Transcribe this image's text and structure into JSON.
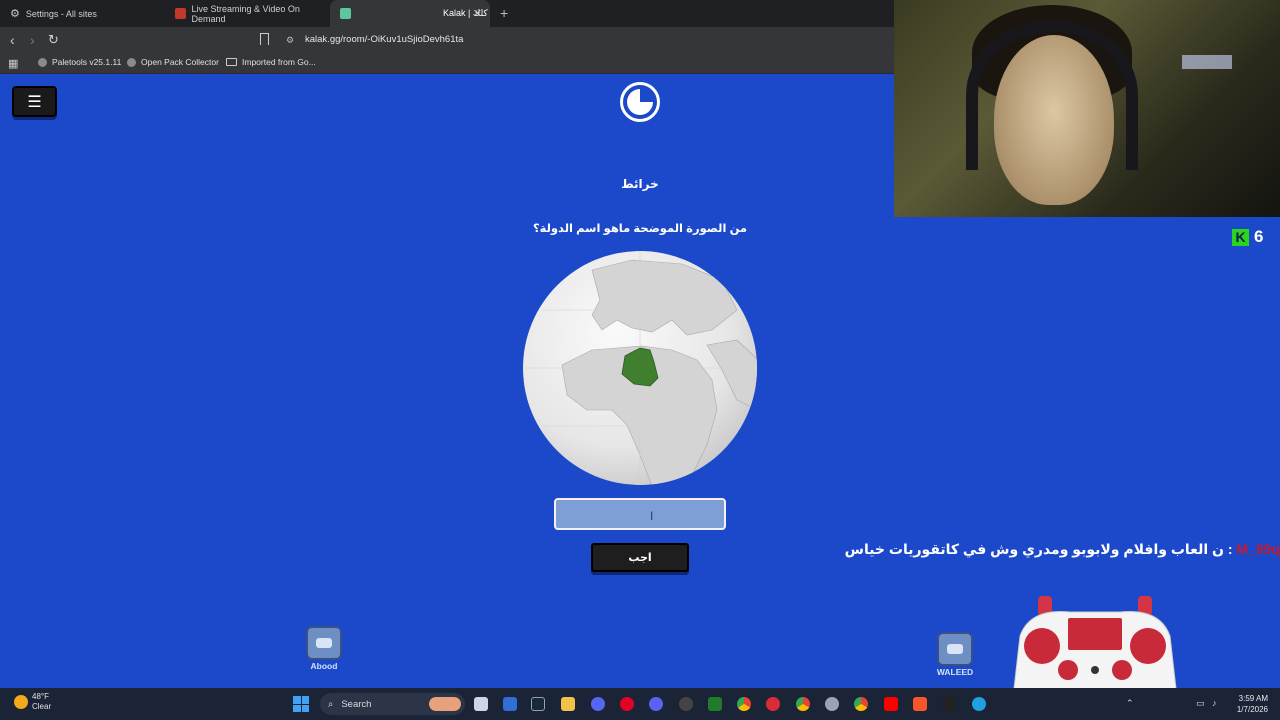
{
  "browser": {
    "tabs": [
      {
        "label": "Settings - All sites",
        "icon": "gear-icon"
      },
      {
        "label": "Live Streaming & Video On Demand",
        "icon": "site-favicon"
      },
      {
        "label": "Kalak | كلك",
        "icon": "kalak-favicon"
      }
    ],
    "url": "kalak.gg/room/-OiKuv1uSjioDevh61ta",
    "bookmarks": [
      {
        "label": "Paletools v25.1.11"
      },
      {
        "label": "Open Pack Collector"
      },
      {
        "label": "Imported from Go..."
      }
    ]
  },
  "game": {
    "category": "خرائط",
    "question": "من الصورة الموضحة ماهو اسم الدولة؟",
    "answer_value": "",
    "submit_label": "اجب",
    "score": "6",
    "score_icon": "K"
  },
  "players": [
    {
      "name": "Abood"
    },
    {
      "name": "WALEED"
    }
  ],
  "ticker": {
    "user": "M_99q",
    "separator": " : ",
    "message": "ن العاب وافلام ولابوبو ومدري وش في كاتقوريات خياس"
  },
  "taskbar": {
    "weather_temp": "48°F",
    "weather_desc": "Clear",
    "search_label": "Search",
    "time": "3:59 AM",
    "date": "1/7/2026"
  },
  "colors": {
    "page_bg": "#1c49c9",
    "highlight_country": "#3f7f2e",
    "ticker_user": "#c41a2b"
  }
}
